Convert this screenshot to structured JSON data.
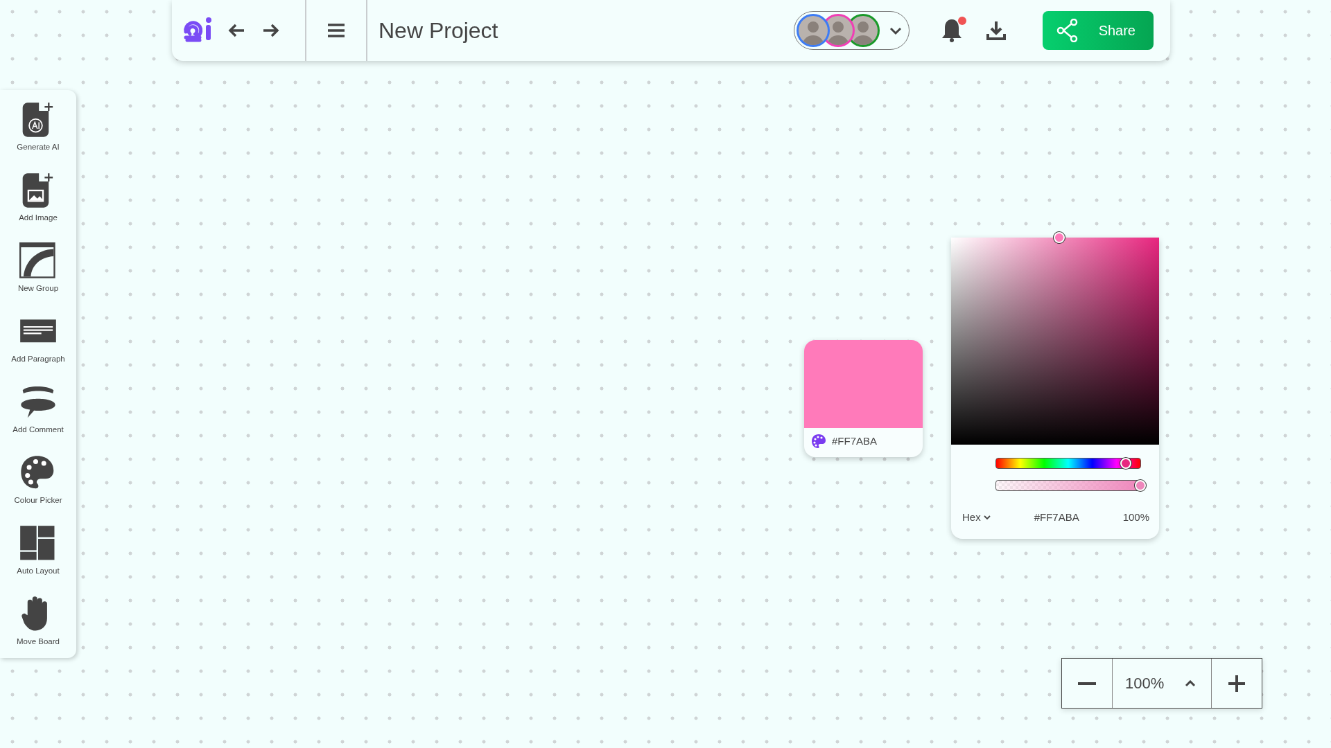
{
  "header": {
    "title": "New Project",
    "collaborators": [
      {
        "color": "#3d7cf5"
      },
      {
        "color": "#f03fb5"
      },
      {
        "color": "#1a9a2a"
      }
    ],
    "has_notifications": true,
    "share_label": "Share"
  },
  "sidebar": {
    "items": [
      {
        "kind": "generate-ai",
        "label": "Generate AI"
      },
      {
        "kind": "add-image",
        "label": "Add Image"
      },
      {
        "kind": "new-group",
        "label": "New Group"
      },
      {
        "kind": "paragraph",
        "label": "Add Paragraph"
      },
      {
        "kind": "comment",
        "label": "Add Comment"
      },
      {
        "kind": "palette",
        "label": "Colour Picker"
      },
      {
        "kind": "layout",
        "label": "Auto Layout"
      },
      {
        "kind": "hand",
        "label": "Move Board"
      }
    ]
  },
  "swatch": {
    "color": "#ff7aba",
    "hex": "#FF7ABA"
  },
  "picker": {
    "color_field": {
      "level": 0.52
    },
    "hue_slider": {
      "level": 0.9
    },
    "alpha_slider": {
      "level": 1
    },
    "format": "Hex",
    "value": "#FF7ABA",
    "alpha": "100%"
  },
  "zoom": {
    "value": "100%"
  }
}
